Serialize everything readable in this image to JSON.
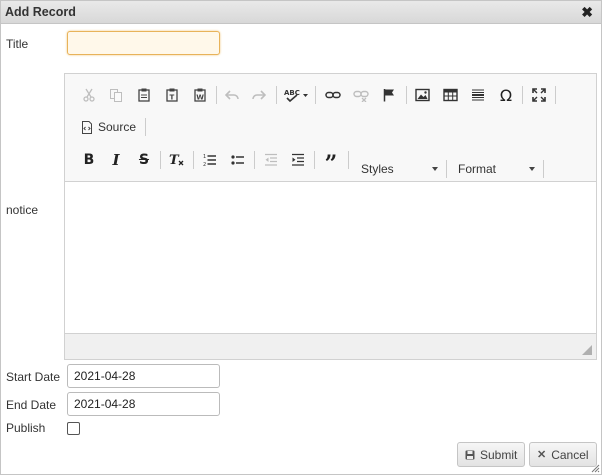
{
  "dialog": {
    "title": "Add Record"
  },
  "form": {
    "title_label": "Title",
    "title_value": "",
    "notice_label": "notice",
    "start_date_label": "Start Date",
    "start_date_value": "2021-04-28",
    "end_date_label": "End Date",
    "end_date_value": "2021-04-28",
    "publish_label": "Publish",
    "publish_checked": false
  },
  "editor": {
    "source_label": "Source",
    "styles_label": "Styles",
    "format_label": "Format",
    "content": ""
  },
  "buttons": {
    "submit_label": "Submit",
    "cancel_label": "Cancel"
  },
  "colors": {
    "focus_border": "#e8b35a",
    "focus_bg": "#fff8ea",
    "toolbar_bg": "#f8f8f8"
  }
}
